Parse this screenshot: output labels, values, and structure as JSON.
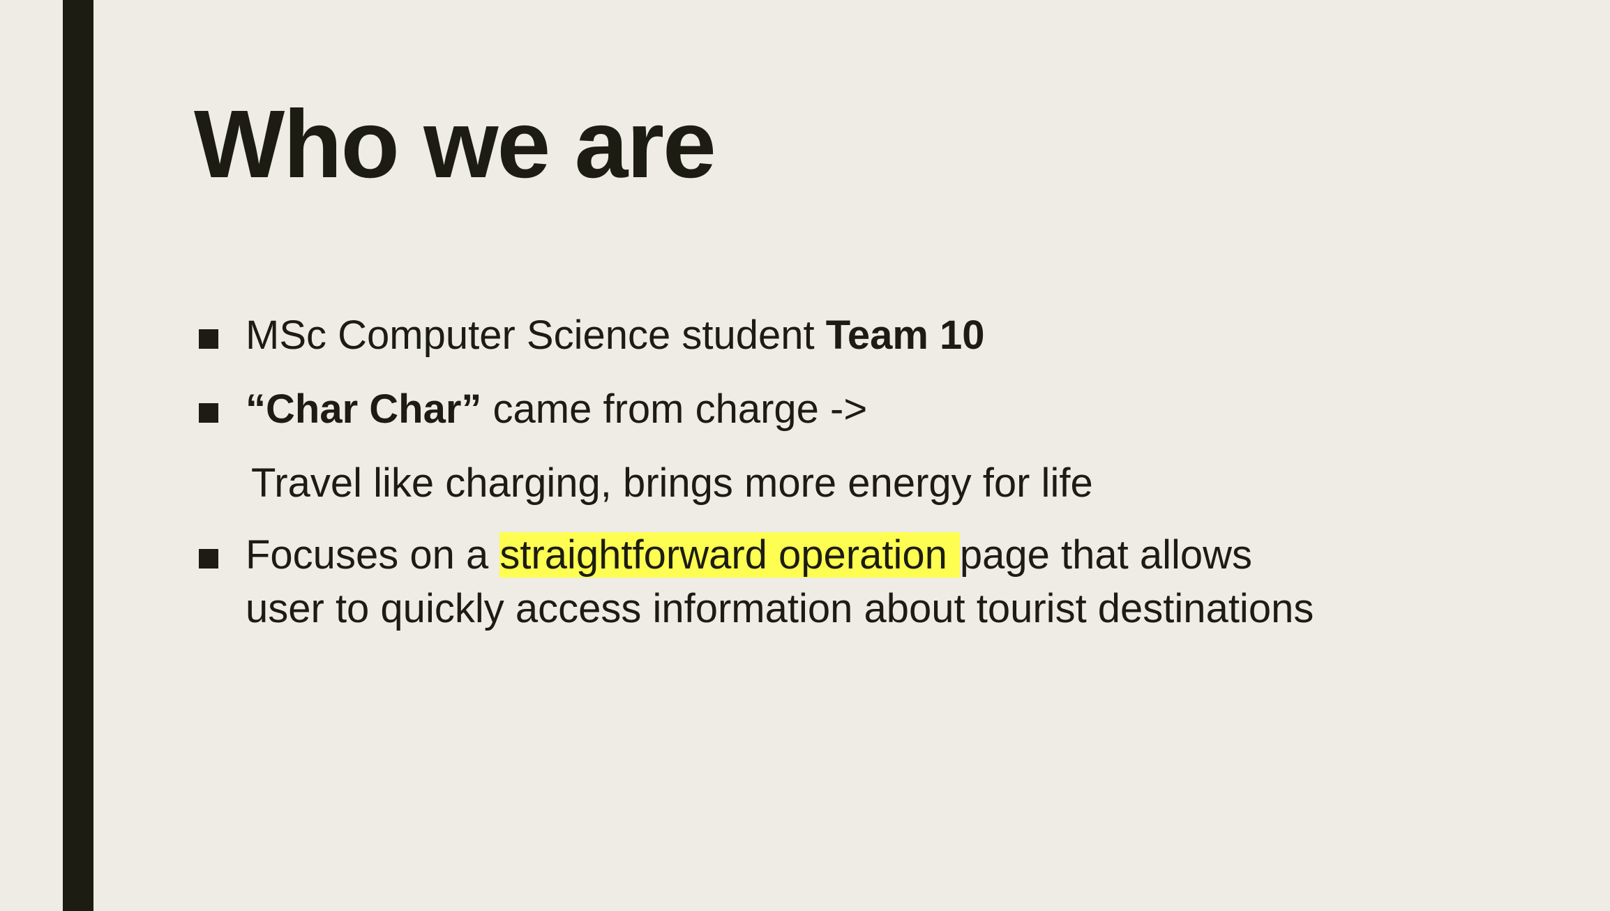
{
  "slide": {
    "title": "Who we are",
    "bullets": [
      {
        "text": "MSc Computer Science student ",
        "bold": "Team 10"
      },
      {
        "bold": "“Char Char”",
        "text": " came from  charge  ->",
        "continuation": "Travel like charging, brings more energy for life"
      },
      {
        "prefix": " Focuses on a ",
        "highlight": "straightforward operation",
        "suffix": "page that allows",
        "continuation": "user to quickly access information about tourist destinations"
      }
    ],
    "colors": {
      "background": "#eeece4",
      "text": "#1c1c12",
      "accent_bar": "#1c1c12",
      "highlight": "#fdfd52"
    }
  }
}
